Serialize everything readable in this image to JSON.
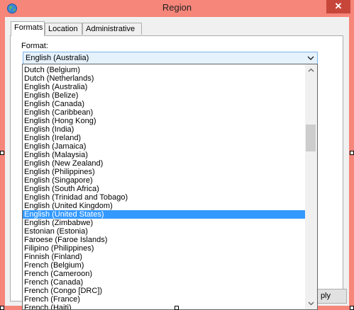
{
  "window": {
    "title": "Region",
    "close_glyph": "✕",
    "app_icon": "globe-icon",
    "titlebar_color": "#f6857a",
    "close_color": "#c7463a"
  },
  "tabs": [
    {
      "label": "Formats",
      "active": true
    },
    {
      "label": "Location",
      "active": false
    },
    {
      "label": "Administrative",
      "active": false
    }
  ],
  "format": {
    "label": "Format:",
    "selected": "English (Australia)"
  },
  "dropdown": {
    "items": [
      "Dutch (Belgium)",
      "Dutch (Netherlands)",
      "English (Australia)",
      "English (Belize)",
      "English (Canada)",
      "English (Caribbean)",
      "English (Hong Kong)",
      "English (India)",
      "English (Ireland)",
      "English (Jamaica)",
      "English (Malaysia)",
      "English (New Zealand)",
      "English (Philippines)",
      "English (Singapore)",
      "English (South Africa)",
      "English (Trinidad and Tobago)",
      "English (United Kingdom)",
      "English (United States)",
      "English (Zimbabwe)",
      "Estonian (Estonia)",
      "Faroese (Faroe Islands)",
      "Filipino (Philippines)",
      "Finnish (Finland)",
      "French (Belgium)",
      "French (Cameroon)",
      "French (Canada)",
      "French (Congo [DRC])",
      "French (France)",
      "French (Haiti)"
    ],
    "highlighted": "English (United States)",
    "highlight_color": "#3399ff"
  },
  "buttons": {
    "apply_partial": "ply"
  }
}
